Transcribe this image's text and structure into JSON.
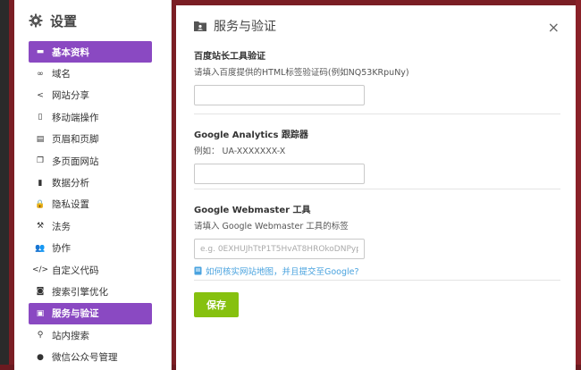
{
  "sidebar": {
    "title": "设置",
    "items": [
      {
        "label": "基本资料",
        "icon": "briefcase-icon",
        "glyph": "▬",
        "active": true
      },
      {
        "label": "域名",
        "icon": "link-icon",
        "glyph": "∞",
        "active": false
      },
      {
        "label": "网站分享",
        "icon": "share-icon",
        "glyph": "<",
        "active": false
      },
      {
        "label": "移动端操作",
        "icon": "mobile-icon",
        "glyph": "▯",
        "active": false
      },
      {
        "label": "页眉和页脚",
        "icon": "header-footer-icon",
        "glyph": "▤",
        "active": false
      },
      {
        "label": "多页面网站",
        "icon": "pages-icon",
        "glyph": "❐",
        "active": false
      },
      {
        "label": "数据分析",
        "icon": "bar-chart-icon",
        "glyph": "▮",
        "active": false
      },
      {
        "label": "隐私设置",
        "icon": "lock-icon",
        "glyph": "🔒",
        "active": false
      },
      {
        "label": "法务",
        "icon": "gavel-icon",
        "glyph": "⚒",
        "active": false
      },
      {
        "label": "协作",
        "icon": "users-icon",
        "glyph": "👥",
        "active": false
      },
      {
        "label": "自定义代码",
        "icon": "code-icon",
        "glyph": "</>",
        "active": false
      },
      {
        "label": "搜索引擎优化",
        "icon": "seo-icon",
        "glyph": "◙",
        "active": false
      },
      {
        "label": "服务与验证",
        "icon": "verify-folder-icon",
        "glyph": "▣",
        "active": true
      },
      {
        "label": "站内搜索",
        "icon": "search-icon",
        "glyph": "⚲",
        "active": false
      },
      {
        "label": "微信公众号管理",
        "icon": "wechat-icon",
        "glyph": "●",
        "active": false
      }
    ]
  },
  "panel": {
    "title": "服务与验证",
    "close_label": "×",
    "baidu": {
      "title": "百度站长工具验证",
      "desc": "请填入百度提供的HTML标签验证码(例如NQ53KRpuNy)",
      "value": "",
      "placeholder": ""
    },
    "analytics": {
      "title": "Google Analytics 跟踪器",
      "desc": "例如：  UA-XXXXXXX-X",
      "value": "",
      "placeholder": ""
    },
    "webmaster": {
      "title": "Google Webmaster 工具",
      "desc": "请填入 Google Webmaster 工具的标签",
      "value": "",
      "placeholder": "e.g. 0EXHUJhTtP1T5HvAT8HROkoDNPypI",
      "help": "如何核实网站地图，并且提交至Google?"
    },
    "save_label": "保存"
  },
  "colors": {
    "accent": "#8a49c2",
    "save": "#86c10f",
    "link": "#4aa3df"
  }
}
